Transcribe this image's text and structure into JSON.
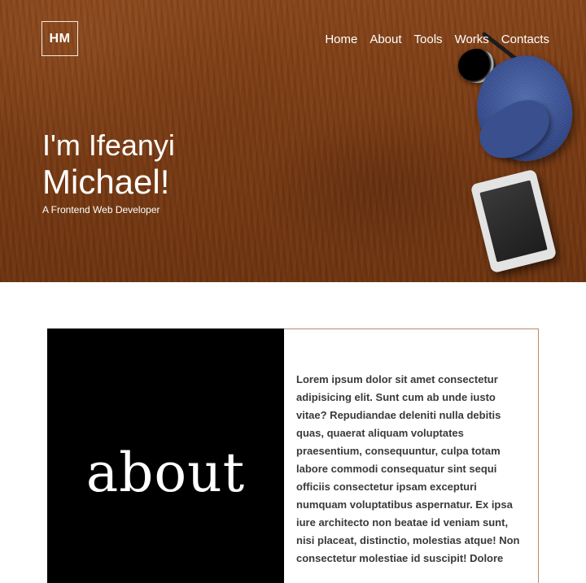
{
  "header": {
    "logo_text": "HM",
    "nav": [
      "Home",
      "About",
      "Tools",
      "Works",
      "Contacts"
    ]
  },
  "hero": {
    "line1": "I'm Ifeanyi",
    "line2": "Michael!",
    "subtitle": "A Frontend Web Developer"
  },
  "about": {
    "heading": "about",
    "text": "Lorem ipsum dolor sit amet consectetur adipisicing elit. Sunt cum ab unde iusto vitae? Repudiandae deleniti nulla debitis quas, quaerat aliquam voluptates praesentium, consequuntur, culpa totam labore commodi consequatur sint sequi officiis consectetur ipsam excepturi numquam voluptatibus aspernatur. Ex ipsa iure architecto non beatae id veniam sunt, nisi placeat, distinctio, molestias atque! Non consectetur molestiae id suscipit! Dolore"
  },
  "colors": {
    "wood": "#8a4418",
    "about_black": "#000000",
    "card_border": "#b98b6a",
    "cap_blue": "#34498a"
  },
  "icons": {
    "glasses": "sunglasses-icon",
    "cap": "cap-icon",
    "tablet": "tablet-icon"
  }
}
